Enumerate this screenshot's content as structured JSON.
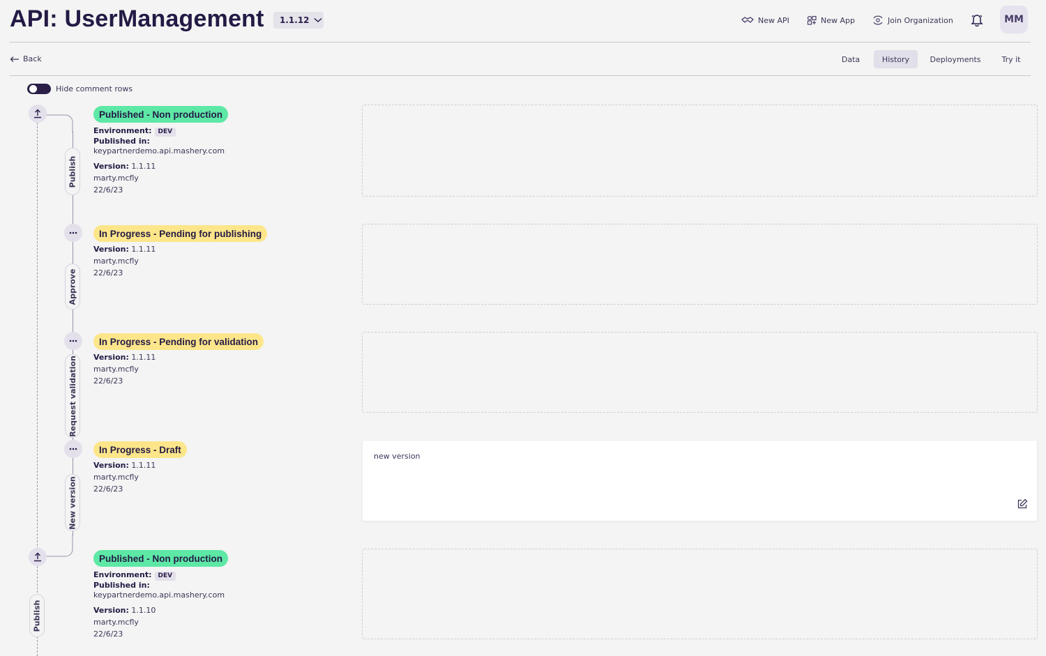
{
  "header": {
    "title": "API: UserManagement",
    "version": "1.1.12",
    "nav": [
      {
        "label": "New API",
        "icon": "handshake-icon"
      },
      {
        "label": "New App",
        "icon": "apps-icon"
      },
      {
        "label": "Join Organization",
        "icon": "organization-icon"
      }
    ],
    "avatar_initials": "MM"
  },
  "subnav": {
    "back_label": "Back",
    "tabs": [
      {
        "label": "Data",
        "active": false
      },
      {
        "label": "History",
        "active": true
      },
      {
        "label": "Deployments",
        "active": false
      },
      {
        "label": "Try it",
        "active": false
      }
    ]
  },
  "toggle": {
    "label": "Hide comment rows",
    "on": true
  },
  "timeline": {
    "entries": [
      {
        "status": "Published - Non production",
        "status_color": "#5de8a6",
        "environment_label": "Environment:",
        "environment": "DEV",
        "published_in_label": "Published in:",
        "published_in": "keypartnerdemo.api.mashery.com",
        "version_label": "Version:",
        "version": "1.1.11",
        "user": "marty.mcfly",
        "date": "22/6/23",
        "action": "Publish",
        "comment": ""
      },
      {
        "status": "In Progress - Pending for publishing",
        "status_color": "#fde68a",
        "version_label": "Version:",
        "version": "1.1.11",
        "user": "marty.mcfly",
        "date": "22/6/23",
        "action": "Approve",
        "comment": ""
      },
      {
        "status": "In Progress - Pending for validation",
        "status_color": "#fde68a",
        "version_label": "Version:",
        "version": "1.1.11",
        "user": "marty.mcfly",
        "date": "22/6/23",
        "action": "Request validation",
        "comment": ""
      },
      {
        "status": "In Progress - Draft",
        "status_color": "#fde68a",
        "version_label": "Version:",
        "version": "1.1.11",
        "user": "marty.mcfly",
        "date": "22/6/23",
        "action": "New version",
        "comment": "new version"
      },
      {
        "status": "Published - Non production",
        "status_color": "#5de8a6",
        "environment_label": "Environment:",
        "environment": "DEV",
        "published_in_label": "Published in:",
        "published_in": "keypartnerdemo.api.mashery.com",
        "version_label": "Version:",
        "version": "1.1.10",
        "user": "marty.mcfly",
        "date": "22/6/23",
        "action": "Publish",
        "comment": ""
      }
    ]
  }
}
